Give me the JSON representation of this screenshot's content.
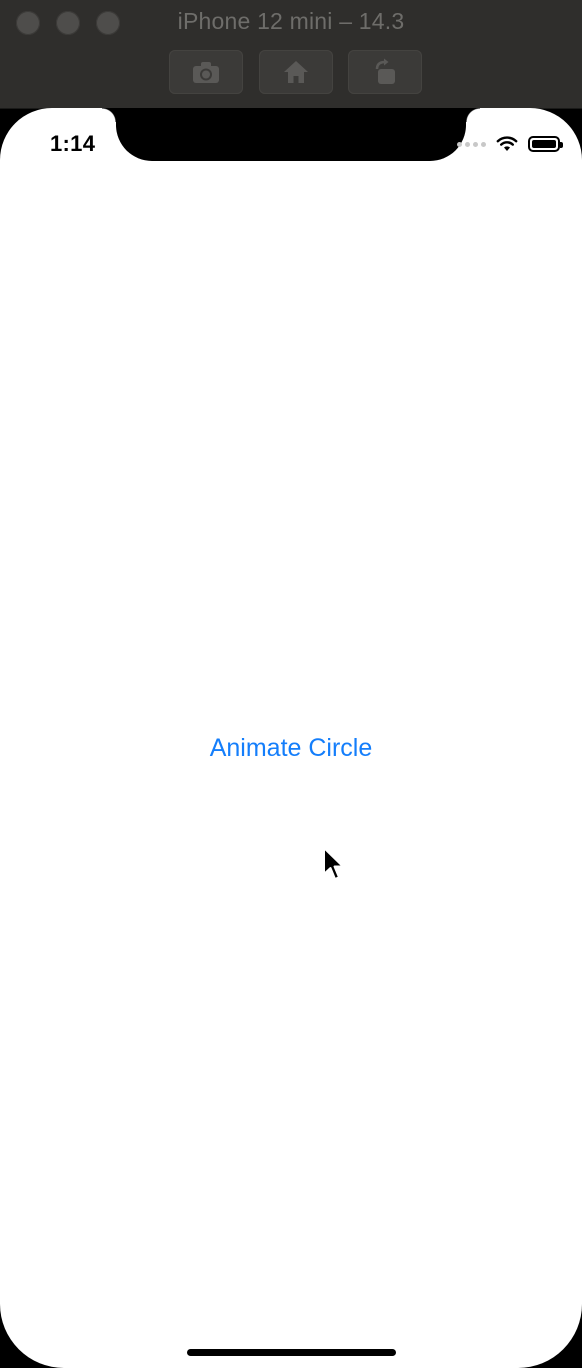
{
  "window": {
    "title": "iPhone 12 mini – 14.3"
  },
  "toolbar": {
    "buttons": [
      {
        "name": "screenshot",
        "icon": "camera-icon"
      },
      {
        "name": "home",
        "icon": "home-icon"
      },
      {
        "name": "rotate",
        "icon": "rotate-icon"
      }
    ]
  },
  "status_bar": {
    "time": "1:14",
    "wifi_icon": "wifi-icon",
    "battery_level": 1.0
  },
  "main": {
    "button_label": "Animate Circle"
  },
  "colors": {
    "accent": "#147efb",
    "titlebar": "#2f2e2c",
    "screen_bg": "#ffffff"
  }
}
